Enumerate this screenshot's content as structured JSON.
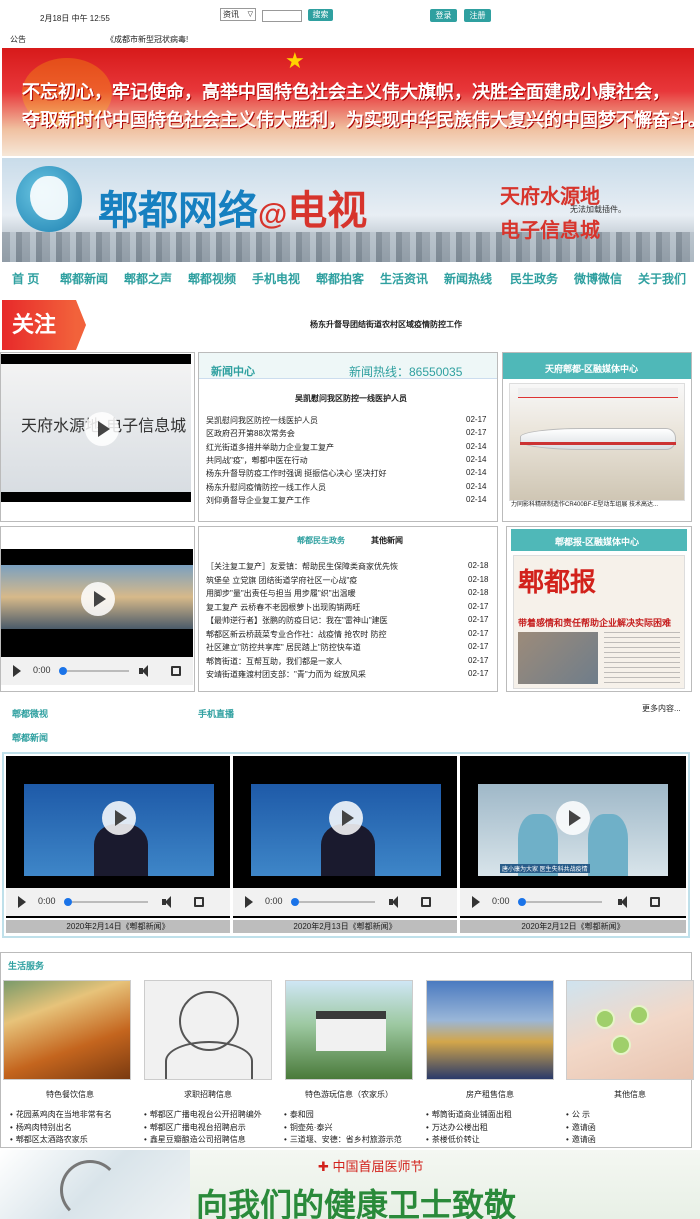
{
  "topbar": {
    "datetime": "2月18日 中午 12:55",
    "search_select": "资讯",
    "search_button": "搜索",
    "login_button": "登录",
    "register_button": "注册"
  },
  "notice": {
    "label": "公告",
    "text": "《成都市新型冠状病毒!"
  },
  "banner_party": {
    "line1": "不忘初心，牢记使命，高举中国特色社会主义伟大旗帜，决胜全面建成小康社会，",
    "line2": "夺取新时代中国特色社会主义伟大胜利，为实现中华民族伟大复兴的中国梦不懈奋斗。"
  },
  "banner_tv": {
    "title_a": "郫都网络",
    "title_b": "@",
    "title_c": "电视",
    "side1": "天府水源地",
    "side_note": "无法加载插件。",
    "side2": "电子信息城"
  },
  "nav": [
    "首 页",
    "郫都新闻",
    "郫都之声",
    "郫都视频",
    "手机电视",
    "郫都拍客",
    "生活资讯",
    "新闻热线",
    "民生政务",
    "微博微信",
    "关于我们"
  ],
  "focus": {
    "tag": "关注",
    "headline": "杨东升督导团结街道农村区域疫情防控工作"
  },
  "video1": {
    "overlay": "天府水源地 电子信息城"
  },
  "news_center": {
    "title": "新闻中心",
    "hotline": "新闻热线：86550035",
    "headline": "吴凯慰问我区防控一线医护人员",
    "items": [
      {
        "text": "吴凯慰问我区防控一线医护人员",
        "date": "02-17"
      },
      {
        "text": "区政府召开第88次常务会",
        "date": "02-17"
      },
      {
        "text": "红光街道多措并举助力企业复工复产",
        "date": "02-14"
      },
      {
        "text": "共同战\"疫\"，郫都中医在行动",
        "date": "02-14"
      },
      {
        "text": "杨东升督导防疫工作时强调 挺振信心决心 坚决打好",
        "date": "02-14"
      },
      {
        "text": "杨东升慰问疫情防控一线工作人员",
        "date": "02-14"
      },
      {
        "text": "刘仰勇督导企业复工复产工作",
        "date": "02-14"
      }
    ]
  },
  "media_center": {
    "title": "天府郫都-区融媒体中心",
    "caption": "力同影科精研制造作CR400BF-E型动车组展 技术高达..."
  },
  "video2": {
    "time": "0:00"
  },
  "gov_news": {
    "tab1": "郫都民生政务",
    "tab2": "其他新闻",
    "items": [
      {
        "text": "［关注复工复产］友爱镇：帮助民生保障类商家优先恢",
        "date": "02-18"
      },
      {
        "text": "筑堡垒 立党旗 团结街道学府社区一心战\"疫",
        "date": "02-18"
      },
      {
        "text": "用脚步\"量\"出责任与担当 用步履\"织\"出温暖",
        "date": "02-18"
      },
      {
        "text": "复工复产 云桥春不老园根萝卜出现购销两旺",
        "date": "02-17"
      },
      {
        "text": "【最帅逆行者】张鹏的防疫日记：我在\"雷神山\"建医",
        "date": "02-17"
      },
      {
        "text": "郫都区新云桥蔬菜专业合作社：战疫情 抢农时 防控",
        "date": "02-17"
      },
      {
        "text": "社区建立\"防控共享库\" 居民踏上\"防控快车道",
        "date": "02-17"
      },
      {
        "text": "郫筒街道：互帮互助，我们都是一家人",
        "date": "02-17"
      },
      {
        "text": "安靖街道雍渡村团支部：\"青\"力而为 绽放风采",
        "date": "02-17"
      }
    ]
  },
  "newspaper": {
    "title": "郫都报-区融媒体中心",
    "masthead": "郫都报",
    "headline": "带着感情和责任帮助企业解决实际困难"
  },
  "links": {
    "weibo": "郫都微视",
    "mobile": "手机直播",
    "more": "更多内容...",
    "news": "郫都新闻"
  },
  "news_videos": [
    {
      "time": "0:00",
      "caption": "2020年2月14日《郫都新闻》"
    },
    {
      "time": "0:00",
      "caption": "2020年2月13日《郫都新闻》"
    },
    {
      "time": "0:00",
      "caption": "2020年2月12日《郫都新闻》"
    }
  ],
  "video3_subtitle": "唐小康为大家 医生失科共战疫情",
  "life": {
    "title": "生活服务",
    "columns": [
      {
        "caption": "特色餐饮信息",
        "items": [
          "花园蒸鸡肉在当地非常有名",
          "杨鸡肉特别出名",
          "郫都区太酒路农家乐"
        ]
      },
      {
        "caption": "求职招聘信息",
        "items": [
          "郫都区广播电视台公开招聘编外",
          "郫都区广播电视台招聘启示",
          "鑫星豆瓣酿造公司招聘信息"
        ]
      },
      {
        "caption": "特色游玩信息（农家乐）",
        "items": [
          "泰和园",
          "铜壶苑·泰兴",
          "三道堰、安德：省乡村旅游示范"
        ]
      },
      {
        "caption": "房产租售信息",
        "items": [
          "郫筒街道商业铺面出租",
          "万达办公楼出租",
          "茶楼低价转让"
        ]
      },
      {
        "caption": "其他信息",
        "items": [
          "公 示",
          "邀请函",
          "邀请函"
        ]
      }
    ]
  },
  "footer_banner": {
    "title": "中国首届医师节",
    "slogan": "向我们的健康卫士致敬"
  }
}
